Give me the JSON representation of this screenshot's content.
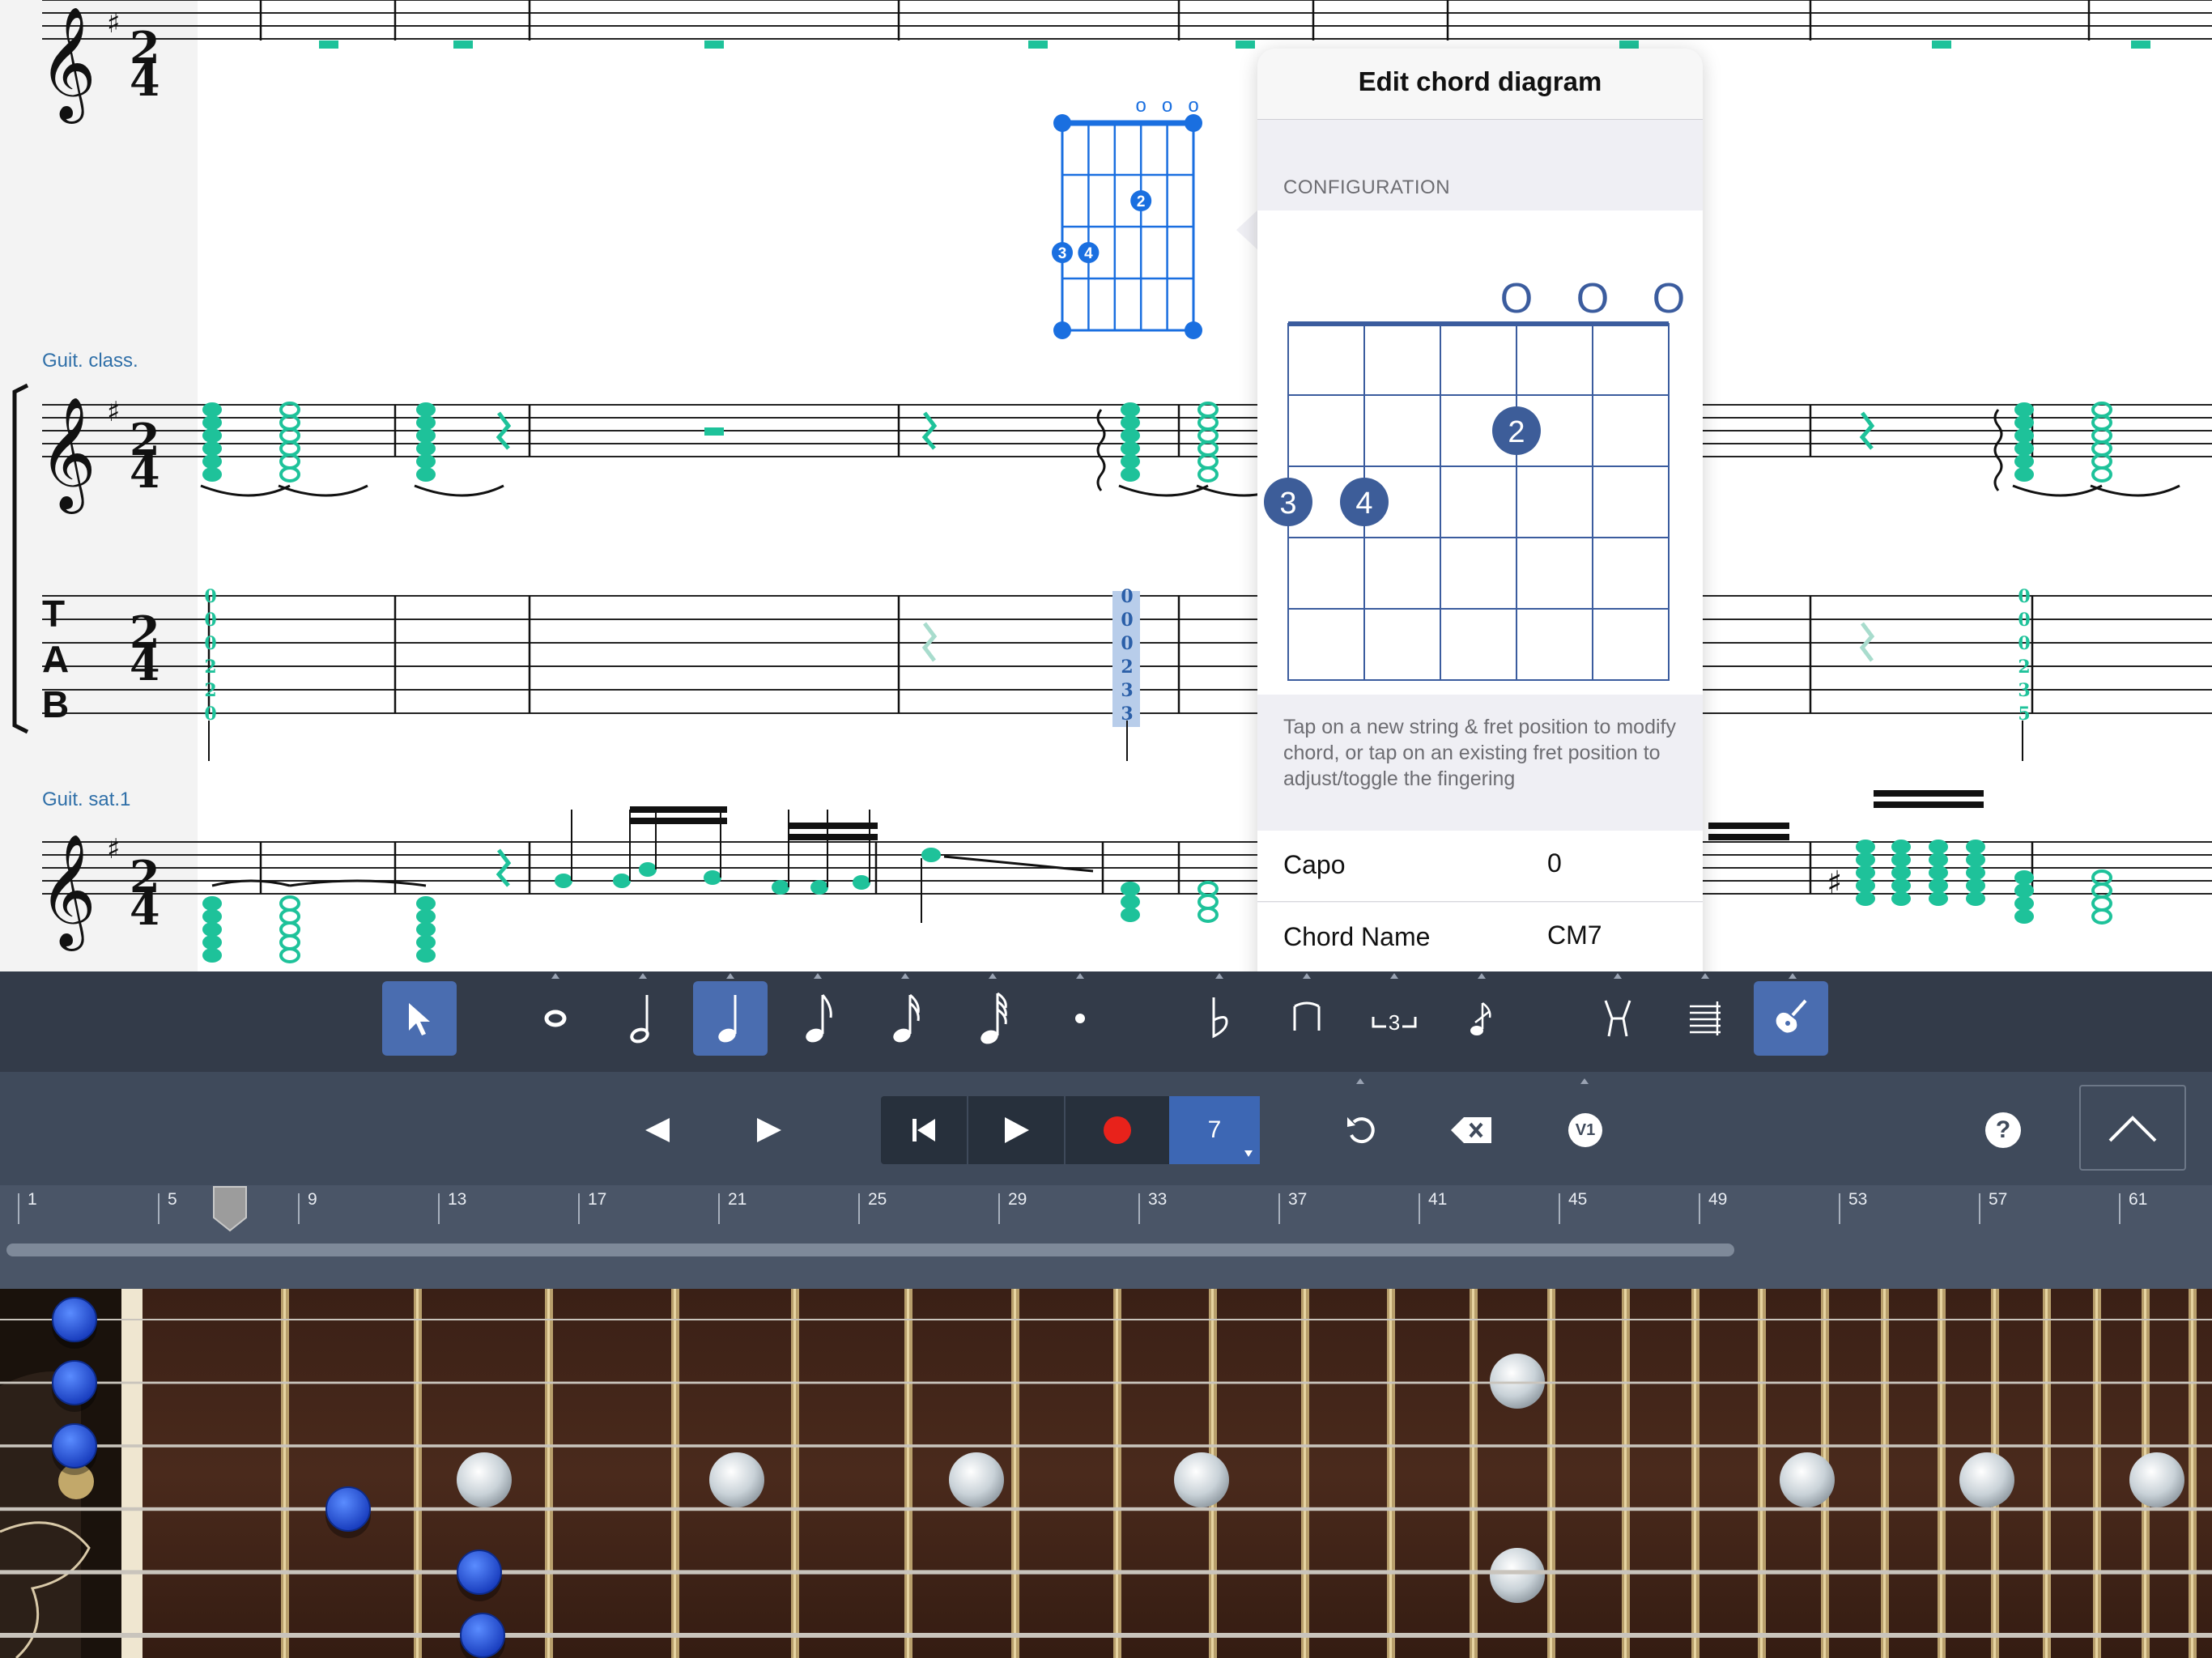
{
  "score": {
    "instrument_1": "Guit. class.",
    "instrument_2": "Guit. sat.1",
    "time_signature_top": "2",
    "time_signature_bottom": "4",
    "tab_label_t": "T",
    "tab_label_a": "A",
    "tab_label_b": "B",
    "key_accidental": "♯",
    "chord_fingers": [
      "2",
      "3",
      "4"
    ],
    "open_strings": [
      "o",
      "o",
      "o"
    ],
    "tab_columns": [
      [
        "0",
        "0",
        "0",
        "2",
        "2",
        "0"
      ],
      [
        "0",
        "0",
        "0",
        "2",
        "3",
        "3"
      ],
      [
        "0",
        "0",
        "0",
        "2",
        "3",
        "5"
      ]
    ]
  },
  "popover": {
    "title": "Edit chord diagram",
    "section_label": "CONFIGURATION",
    "open_markers": [
      "O",
      "O",
      "O"
    ],
    "fingers": [
      {
        "label": "2",
        "string": 3,
        "fret": 2
      },
      {
        "label": "3",
        "string": 0,
        "fret": 3
      },
      {
        "label": "4",
        "string": 1,
        "fret": 3
      }
    ],
    "help_text": "Tap on a new string & fret position to modify chord, or tap on an existing fret position to adjust/toggle the fingering",
    "capo_label": "Capo",
    "capo_value": "0",
    "chord_name_label": "Chord Name",
    "chord_name_value": "CM7"
  },
  "toolbar": {
    "active_tools": [
      "select-tool",
      "quarter-note",
      "chord-diagram-tool"
    ],
    "accent_color": "#4a6db0"
  },
  "transport": {
    "bar_count": "7",
    "voice_label": "V1",
    "help_label": "?",
    "record_color": "#e8221b"
  },
  "timeline": {
    "labels": [
      "1",
      "5",
      "9",
      "13",
      "17",
      "21",
      "25",
      "29",
      "33",
      "37",
      "41",
      "45",
      "49",
      "53",
      "57",
      "61"
    ]
  },
  "colors": {
    "note_green": "#1ec29a",
    "selection_blue": "#1a6fe0",
    "diagram_blue": "#3b5c9e",
    "finger_dot": "#3d5d99"
  }
}
